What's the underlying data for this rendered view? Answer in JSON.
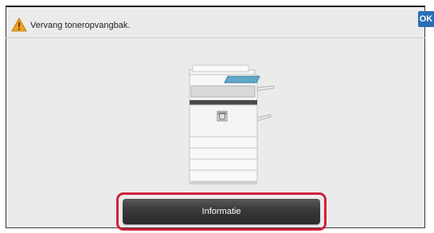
{
  "header": {
    "message": "Vervang toneropvangbak.",
    "warning_icon": "warning-triangle-icon",
    "ok_label": "OK"
  },
  "main": {
    "illustration": "copier-waste-toner-icon",
    "info_button_label": "Informatie"
  },
  "colors": {
    "ok_button": "#2a6fb5",
    "highlight_frame": "#d0213a",
    "warning": "#f0a020"
  }
}
